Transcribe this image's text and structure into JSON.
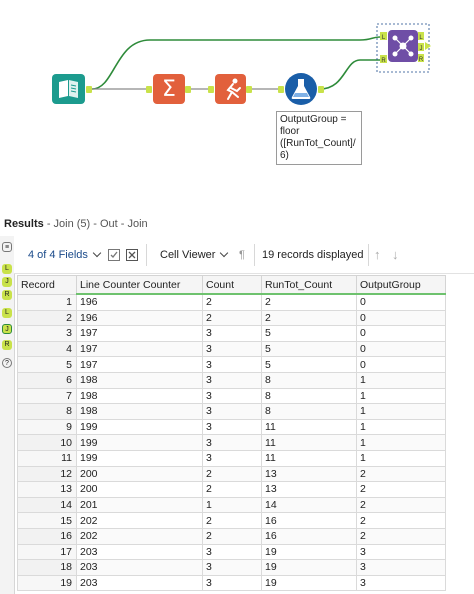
{
  "canvas": {
    "annotation_lines": [
      "OutputGroup =",
      "floor",
      "([RunTot_Count]/",
      "6)"
    ],
    "tools": [
      "input-data-icon",
      "summarize-icon",
      "running-total-icon",
      "formula-icon",
      "join-icon"
    ],
    "join_anchors": {
      "left": "L",
      "right": "R",
      "join": "J",
      "out_left": "L",
      "out_join": "J",
      "out_right": "R"
    },
    "colors": {
      "input": "#1c9b8e",
      "summarize": "#e2603c",
      "formula": "#1a5ea8",
      "join": "#6f4ea6",
      "connector": "#2e8b3a"
    }
  },
  "results": {
    "title": "Results",
    "subtitle": "- Join (5) - Out - Join"
  },
  "sidebar": {
    "anchors": [
      "L",
      "J",
      "R",
      "L",
      "J",
      "R",
      "?"
    ]
  },
  "toolbar": {
    "fields_label": "4 of 4 Fields",
    "cell_viewer_label": "Cell Viewer",
    "pilcrow": "¶",
    "records_label": "19 records displayed",
    "up_arrow": "↑",
    "down_arrow": "↓"
  },
  "table": {
    "columns": [
      "Record",
      "Line Counter Counter",
      "Count",
      "RunTot_Count",
      "OutputGroup"
    ],
    "rows": [
      [
        "1",
        "196",
        "2",
        "2",
        "0"
      ],
      [
        "2",
        "196",
        "2",
        "2",
        "0"
      ],
      [
        "3",
        "197",
        "3",
        "5",
        "0"
      ],
      [
        "4",
        "197",
        "3",
        "5",
        "0"
      ],
      [
        "5",
        "197",
        "3",
        "5",
        "0"
      ],
      [
        "6",
        "198",
        "3",
        "8",
        "1"
      ],
      [
        "7",
        "198",
        "3",
        "8",
        "1"
      ],
      [
        "8",
        "198",
        "3",
        "8",
        "1"
      ],
      [
        "9",
        "199",
        "3",
        "11",
        "1"
      ],
      [
        "10",
        "199",
        "3",
        "11",
        "1"
      ],
      [
        "11",
        "199",
        "3",
        "11",
        "1"
      ],
      [
        "12",
        "200",
        "2",
        "13",
        "2"
      ],
      [
        "13",
        "200",
        "2",
        "13",
        "2"
      ],
      [
        "14",
        "201",
        "1",
        "14",
        "2"
      ],
      [
        "15",
        "202",
        "2",
        "16",
        "2"
      ],
      [
        "16",
        "202",
        "2",
        "16",
        "2"
      ],
      [
        "17",
        "203",
        "3",
        "19",
        "3"
      ],
      [
        "18",
        "203",
        "3",
        "19",
        "3"
      ],
      [
        "19",
        "203",
        "3",
        "19",
        "3"
      ]
    ]
  }
}
